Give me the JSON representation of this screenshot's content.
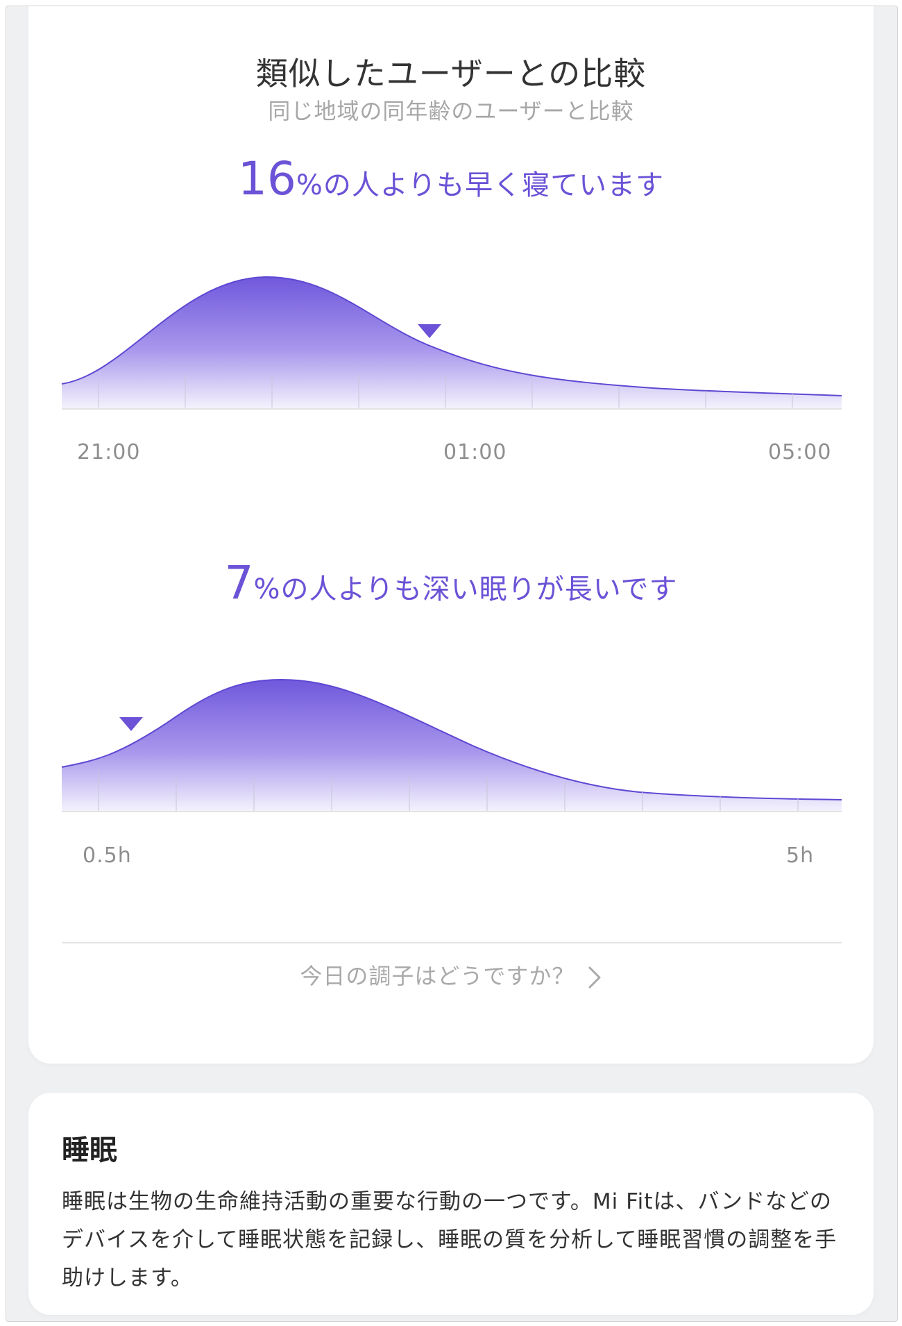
{
  "comparison": {
    "title": "類似したユーザーとの比較",
    "subtitle": "同じ地域の同年齢のユーザーと比較",
    "bedtime": {
      "number": "16",
      "text": "%の人よりも早く寝ています",
      "tick_labels": [
        "21:00",
        "01:00",
        "05:00"
      ]
    },
    "deep_sleep": {
      "number": "7",
      "text": "%の人よりも深い眠りが長いです",
      "tick_labels": [
        "0.5h",
        "5h"
      ]
    },
    "prompt": "今日の調子はどうですか？",
    "accent_color": "#6b52d6",
    "icons": [
      "triangle-marker-icon",
      "chevron-right-icon"
    ]
  },
  "sleep_info": {
    "title": "睡眠",
    "body": "睡眠は生物の生命維持活動の重要な行動の一つです。Mi Fitは、バンドなどのデバイスを介して睡眠状態を記録し、睡眠の質を分析して睡眠習慣の調整を手助けします。"
  }
}
